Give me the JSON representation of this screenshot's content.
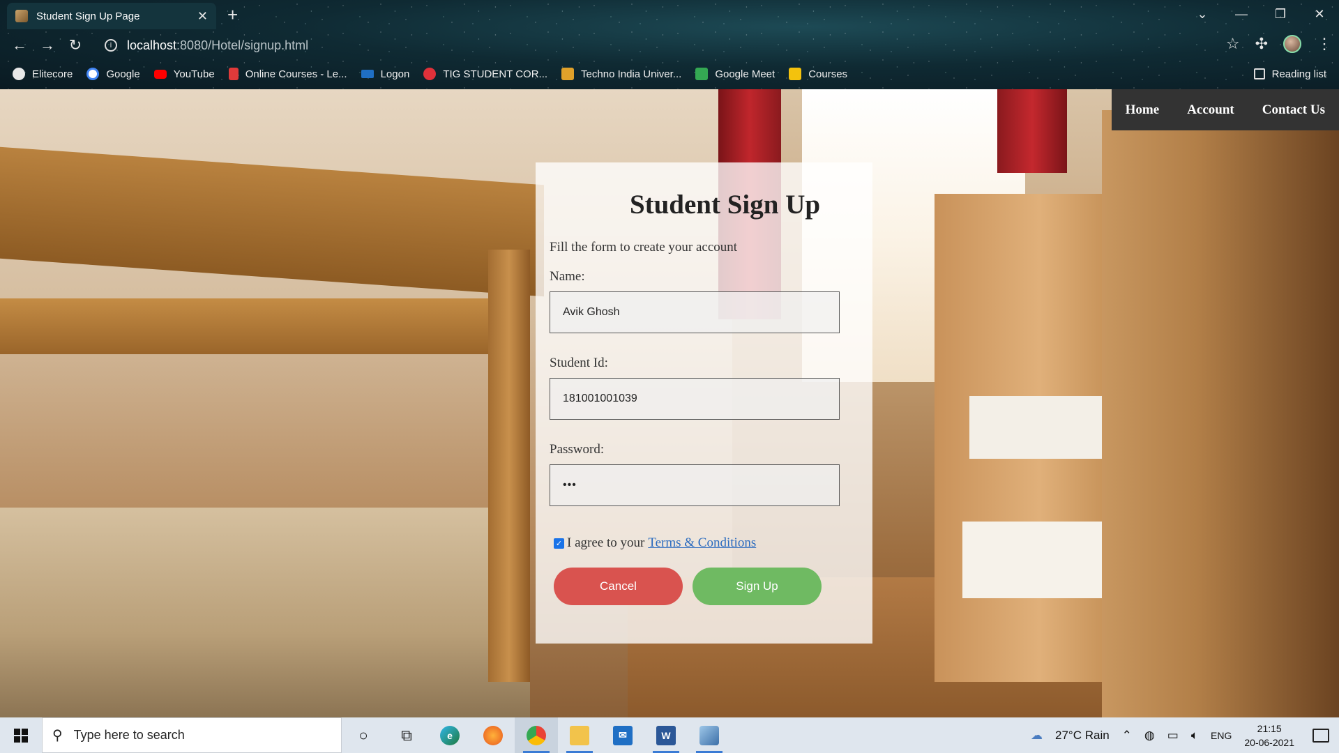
{
  "browser": {
    "tab_title": "Student Sign Up Page",
    "tab_close": "✕",
    "new_tab": "+",
    "url_host": "localhost",
    "url_path": ":8080/Hotel/signup.html",
    "bookmarks": [
      {
        "label": "Elitecore",
        "color": "#e8e8e8"
      },
      {
        "label": "Google",
        "color": "#4285f4"
      },
      {
        "label": "YouTube",
        "color": "#ff0000"
      },
      {
        "label": "Online Courses - Le...",
        "color": "#e03a3a"
      },
      {
        "label": "Logon",
        "color": "#1f6fc4"
      },
      {
        "label": "TIG STUDENT COR...",
        "color": "#e0313a"
      },
      {
        "label": "Techno India Univer...",
        "color": "#e0a12a"
      },
      {
        "label": "Google Meet",
        "color": "#34a853"
      },
      {
        "label": "Courses",
        "color": "#f4c20d"
      }
    ],
    "reading_list": "Reading list"
  },
  "nav": {
    "home": "Home",
    "account": "Account",
    "contact": "Contact Us"
  },
  "form": {
    "title": "Student Sign Up",
    "subtitle": "Fill the form to create your account",
    "name_label": "Name:",
    "name_value": "Avik Ghosh",
    "id_label": "Student Id:",
    "id_value": "181001001039",
    "password_label": "Password:",
    "password_value": "•••",
    "agree_text": "I agree to your",
    "terms_link": "Terms & Conditions",
    "agree_checked": true,
    "cancel_label": "Cancel",
    "signup_label": "Sign Up"
  },
  "taskbar": {
    "search_placeholder": "Type here to search",
    "weather": "27°C  Rain",
    "language": "ENG",
    "time": "21:15",
    "date": "20-06-2021"
  }
}
